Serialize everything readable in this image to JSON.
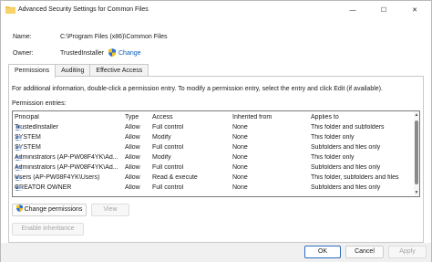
{
  "window": {
    "title": "Advanced Security Settings for Common Files",
    "minimize_glyph": "—",
    "maximize_glyph": "☐",
    "close_glyph": "✕"
  },
  "object": {
    "name_label": "Name:",
    "name_value": "C:\\Program Files (x86)\\Common Files",
    "owner_label": "Owner:",
    "owner_value": "TrustedInstaller",
    "change_label": "Change"
  },
  "tabs": [
    {
      "label": "Permissions",
      "active": true
    },
    {
      "label": "Auditing",
      "active": false
    },
    {
      "label": "Effective Access",
      "active": false
    }
  ],
  "permissions": {
    "info": "For additional information, double-click a permission entry. To modify a permission entry, select the entry and click Edit (if available).",
    "entries_label": "Permission entries:",
    "columns": [
      "Principal",
      "Type",
      "Access",
      "Inherited from",
      "Applies to"
    ],
    "rows": [
      {
        "principal": "TrustedInstaller",
        "type": "Allow",
        "access": "Full control",
        "inherited": "None",
        "applies": "This folder and subfolders"
      },
      {
        "principal": "SYSTEM",
        "type": "Allow",
        "access": "Modify",
        "inherited": "None",
        "applies": "This folder only"
      },
      {
        "principal": "SYSTEM",
        "type": "Allow",
        "access": "Full control",
        "inherited": "None",
        "applies": "Subfolders and files only"
      },
      {
        "principal": "Administrators (AP-PW08F4YK\\Ad...",
        "type": "Allow",
        "access": "Modify",
        "inherited": "None",
        "applies": "This folder only"
      },
      {
        "principal": "Administrators (AP-PW08F4YK\\Ad...",
        "type": "Allow",
        "access": "Full control",
        "inherited": "None",
        "applies": "Subfolders and files only"
      },
      {
        "principal": "Users (AP-PW08F4YK\\Users)",
        "type": "Allow",
        "access": "Read & execute",
        "inherited": "None",
        "applies": "This folder, subfolders and files"
      },
      {
        "principal": "CREATOR OWNER",
        "type": "Allow",
        "access": "Full control",
        "inherited": "None",
        "applies": "Subfolders and files only"
      }
    ],
    "change_permissions_label": "Change permissions",
    "view_label": "View",
    "enable_inheritance_label": "Enable inheritance"
  },
  "footer": {
    "ok_label": "OK",
    "cancel_label": "Cancel",
    "apply_label": "Apply"
  },
  "colors": {
    "accent": "#0a5cb8",
    "folder": "#f2c34a",
    "shield_blue": "#2f6fd6",
    "shield_yellow": "#f5c518"
  }
}
